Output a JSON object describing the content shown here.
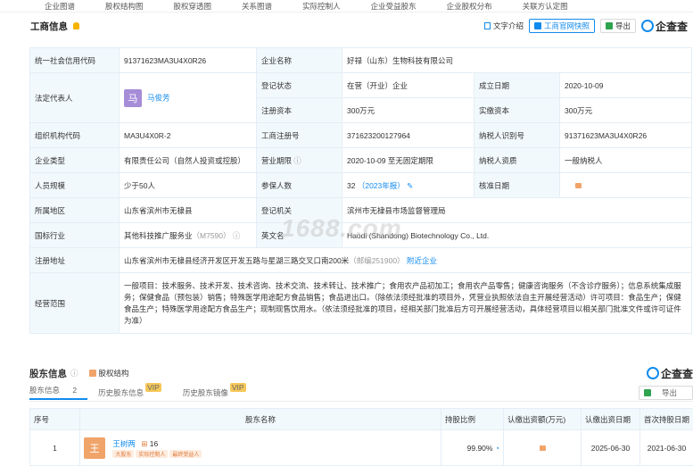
{
  "nav": [
    "企业图谱",
    "股权结构图",
    "股权穿透图",
    "关系图谱",
    "实际控制人",
    "企业受益股东",
    "企业股权分布",
    "关联方认定图"
  ],
  "header": {
    "title": "工商信息",
    "doc_intro": "文字介绍",
    "official_express": "工商官网快照",
    "export": "导出",
    "brand": "企查查"
  },
  "info": {
    "credit_code_k": "统一社会信用代码",
    "credit_code": "91371623MA3U4X0R26",
    "name_k": "企业名称",
    "name": "好禄（山东）生物科技有限公司",
    "legal_k": "法定代表人",
    "legal_avatar": "马",
    "legal": "马俊芳",
    "reg_status_k": "登记状态",
    "reg_status": "在营（开业）企业",
    "found_k": "成立日期",
    "found": "2020-10-09",
    "reg_cap_k": "注册资本",
    "reg_cap": "300万元",
    "paid_cap_k": "实缴资本",
    "paid_cap": "300万元",
    "org_code_k": "组织机构代码",
    "org_code": "MA3U4X0R-2",
    "biz_reg_k": "工商注册号",
    "biz_reg": "371623200127964",
    "tax_id_k": "纳税人识别号",
    "tax_id": "91371623MA3U4X0R26",
    "type_k": "企业类型",
    "type": "有限责任公司（自然人投资或控股）",
    "term_k": "营业期限",
    "term": "2020-10-09 至无固定期限",
    "tax_q_k": "纳税人资质",
    "tax_q": "一般纳税人",
    "staff_k": "人员规模",
    "staff": "少于50人",
    "insured_k": "参保人数",
    "insured": "32",
    "insured_note": "（2023年报）",
    "approve_k": "核准日期",
    "area_k": "所属地区",
    "area": "山东省滨州市无棣县",
    "authority_k": "登记机关",
    "authority": "滨州市无棣县市场监督管理局",
    "industry_k": "国标行业",
    "industry": "其他科技推广服务业",
    "industry_code": "（M7590）",
    "en_k": "英文名",
    "en": "Haodi (Shandong) Biotechnology Co., Ltd.",
    "addr_k": "注册地址",
    "addr": "山东省滨州市无棣县经济开发区开发五路与星湖三路交叉口南200米",
    "zip": "（邮编251900）",
    "nearby": "附近企业",
    "scope_k": "经营范围",
    "scope": "一般项目：技术服务、技术开发、技术咨询、技术交流、技术转让、技术推广；食用农产品初加工；食用农产品零售；健康咨询服务（不含诊疗服务）；信息系统集成服务；保健食品（预包装）销售；特殊医学用途配方食品销售；食品进出口。（除依法须经批准的项目外，凭营业执照依法自主开展经营活动）许可项目：食品生产；保健食品生产；特殊医学用途配方食品生产；现制现售饮用水。（依法须经批准的项目，经相关部门批准后方可开展经营活动，具体经营项目以相关部门批准文件或许可证件为准）"
  },
  "watermark": "1688.com",
  "shareholders": {
    "title": "股东信息",
    "equity_struct": "股权结构",
    "brand": "企查查",
    "export": "导出",
    "tabs": [
      {
        "label": "股东信息",
        "count": "2"
      },
      {
        "label": "历史股东信息"
      },
      {
        "label": "历史股东镜像"
      }
    ],
    "vip": "VIP",
    "cols": [
      "序号",
      "股东名称",
      "持股比例",
      "认缴出资额(万元)",
      "认缴出资日期",
      "首次持股日期"
    ],
    "rows": [
      {
        "no": "1",
        "avatar": "王",
        "name": "王树两",
        "links": "16",
        "tags": [
          "大股东",
          "实际控制人",
          "最终受益人"
        ],
        "ratio": "99.90%",
        "date": "2025-06-30",
        "first": "2021-06-30"
      }
    ]
  },
  "colors": {
    "accent": "#128bed",
    "key_bg": "#f2f9fc",
    "avatar": "#a78cd8"
  }
}
